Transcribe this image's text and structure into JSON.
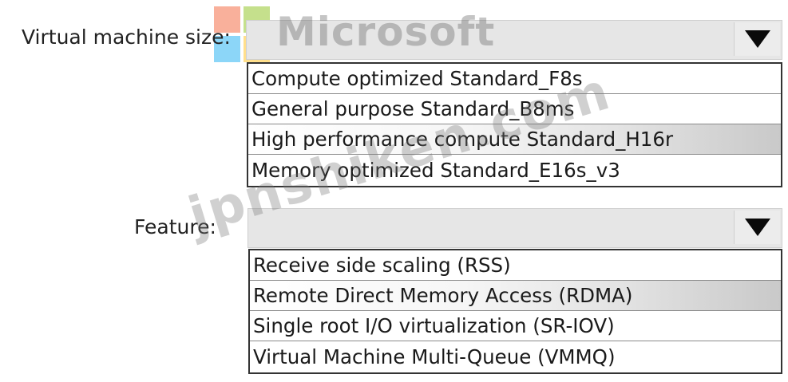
{
  "vm_size": {
    "label": "Virtual machine size:",
    "options": [
      "Compute optimized Standard_F8s",
      "General purpose Standard_B8ms",
      "High performance compute Standard_H16r",
      "Memory optimized Standard_E16s_v3"
    ],
    "highlighted_index": 2
  },
  "feature": {
    "label": "Feature:",
    "options": [
      "Receive side scaling (RSS)",
      "Remote Direct Memory Access (RDMA)",
      "Single root I/O virtualization (SR-IOV)",
      "Virtual Machine Multi-Queue (VMMQ)"
    ],
    "highlighted_index": 1
  },
  "watermark": {
    "logo_text": "Microsoft",
    "site_text": "jpnshiken.com"
  },
  "colors": {
    "ms_red": "#f25022",
    "ms_green": "#7fba00",
    "ms_blue": "#00a4ef",
    "ms_yellow": "#ffb900"
  }
}
